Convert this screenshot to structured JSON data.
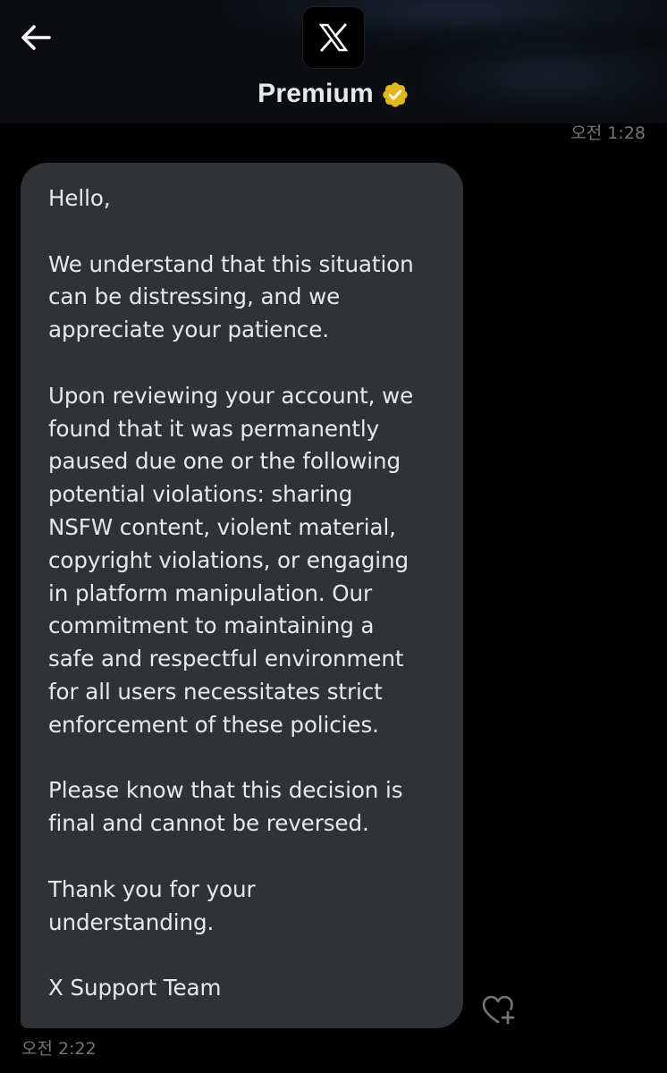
{
  "header": {
    "title": "Premium",
    "back_icon": "arrow-left-icon",
    "avatar_icon": "x-logo-icon",
    "badge_icon": "verified-badge-icon",
    "badge_color": "#e2b719"
  },
  "conversation": {
    "timestamp_top": "오전 1:28",
    "message": {
      "paragraphs": [
        "Hello,",
        "We understand that this situation\ncan be distressing, and we\nappreciate your patience.",
        "Upon reviewing your account, we\nfound that it was permanently\npaused due one or the following\npotential violations: sharing\nNSFW content, violent material,\ncopyright violations, or engaging\nin platform manipulation. Our\ncommitment to maintaining a\nsafe and respectful environment\nfor all users necessitates strict\nenforcement of these policies.",
        "Please know that this decision is\nfinal and cannot be reversed.",
        "Thank you for your\nunderstanding.",
        "X Support Team"
      ],
      "timestamp": "오전 2:22",
      "react_icon": "add-reaction-heart-icon"
    }
  },
  "colors": {
    "background": "#000000",
    "header_background": "#0b0d10",
    "bubble": "#2f3336",
    "text": "#e7e9ea",
    "muted": "#71767b"
  }
}
